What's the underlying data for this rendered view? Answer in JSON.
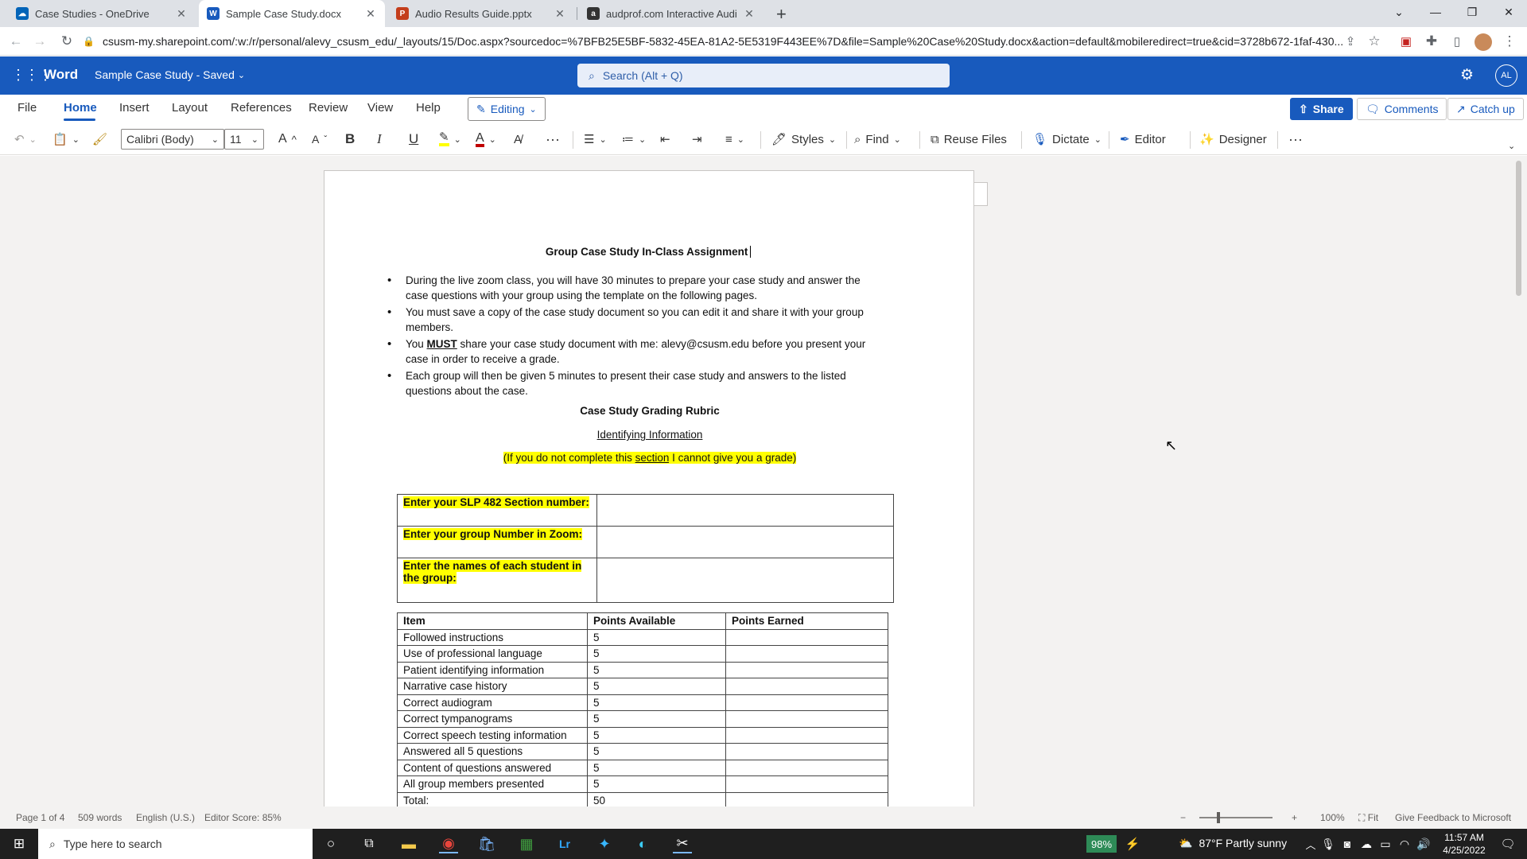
{
  "browser": {
    "tabs": [
      {
        "title": "Case Studies - OneDrive",
        "icon": "onedrive-icon"
      },
      {
        "title": "Sample Case Study.docx",
        "icon": "word-icon"
      },
      {
        "title": "Audio Results Guide.pptx",
        "icon": "powerpoint-icon"
      },
      {
        "title": "audprof.com Interactive Audiogr",
        "icon": "audprof-icon"
      }
    ],
    "url": "csusm-my.sharepoint.com/:w:/r/personal/alevy_csusm_edu/_layouts/15/Doc.aspx?sourcedoc=%7BFB25E5BF-5832-45EA-81A2-5E5319F443EE%7D&file=Sample%20Case%20Study.docx&action=default&mobileredirect=true&cid=3728b672-1faf-430..."
  },
  "word": {
    "app_name": "Word",
    "doc_title": "Sample Case Study  -  Saved",
    "search_placeholder": "Search (Alt + Q)",
    "avatar_initials": "AL",
    "ribbon_tabs": [
      "File",
      "Home",
      "Insert",
      "Layout",
      "References",
      "Review",
      "View",
      "Help"
    ],
    "editing_label": "Editing",
    "share_label": "Share",
    "comments_label": "Comments",
    "catchup_label": "Catch up",
    "font_name": "Calibri (Body)",
    "font_size": "11",
    "toolbar": {
      "styles": "Styles",
      "find": "Find",
      "reuse": "Reuse Files",
      "dictate": "Dictate",
      "editor": "Editor",
      "designer": "Designer"
    }
  },
  "document": {
    "title": "Group Case Study In-Class Assignment",
    "bullets": [
      {
        "text": "During the live zoom class, you will have 30 minutes to prepare your case study and answer the case questions with your group using the template on the following pages."
      },
      {
        "text": "You must save a copy of the case study document so you can edit it and share it with your group members."
      },
      {
        "pre": "You ",
        "bold": "MUST",
        "post": " share your case study document with me: alevy@csusm.edu before you present your case in order to receive a grade."
      },
      {
        "text": "Each group will then be given 5 minutes to present their case study and answers to the listed questions about the case."
      }
    ],
    "rubric_title": "Case Study Grading Rubric",
    "identifying_info": "Identifying Information",
    "notice_pre": "(If you do not complete this ",
    "notice_link": "section",
    "notice_post": " I cannot give you a grade)",
    "info_rows": [
      "Enter your SLP 482 Section number:",
      "Enter your group Number in Zoom:",
      "Enter the names of each student in the group:"
    ],
    "rubric_headers": [
      "Item",
      "Points Available",
      "Points Earned"
    ],
    "rubric_rows": [
      [
        "Followed instructions",
        "5",
        ""
      ],
      [
        "Use of professional language",
        "5",
        ""
      ],
      [
        "Patient identifying information",
        "5",
        ""
      ],
      [
        "Narrative case history",
        "5",
        ""
      ],
      [
        "Correct audiogram",
        "5",
        ""
      ],
      [
        "Correct tympanograms",
        "5",
        ""
      ],
      [
        "Correct speech testing information",
        "5",
        ""
      ],
      [
        "Answered all 5 questions",
        "5",
        ""
      ],
      [
        "Content of questions answered",
        "5",
        ""
      ],
      [
        "All group members presented",
        "5",
        ""
      ],
      [
        "Total:",
        "50",
        ""
      ]
    ]
  },
  "statusbar": {
    "page": "Page 1 of 4",
    "words": "509 words",
    "language": "English (U.S.)",
    "editor_score": "Editor Score: 85%",
    "zoom": "100%",
    "fit": "Fit",
    "feedback": "Give Feedback to Microsoft"
  },
  "taskbar": {
    "search_placeholder": "Type here to search",
    "battery": "98%",
    "weather": "87°F  Partly sunny",
    "time": "11:57 AM",
    "date": "4/25/2022"
  },
  "colors": {
    "word_blue": "#185abd",
    "highlight": "#ffff00"
  }
}
